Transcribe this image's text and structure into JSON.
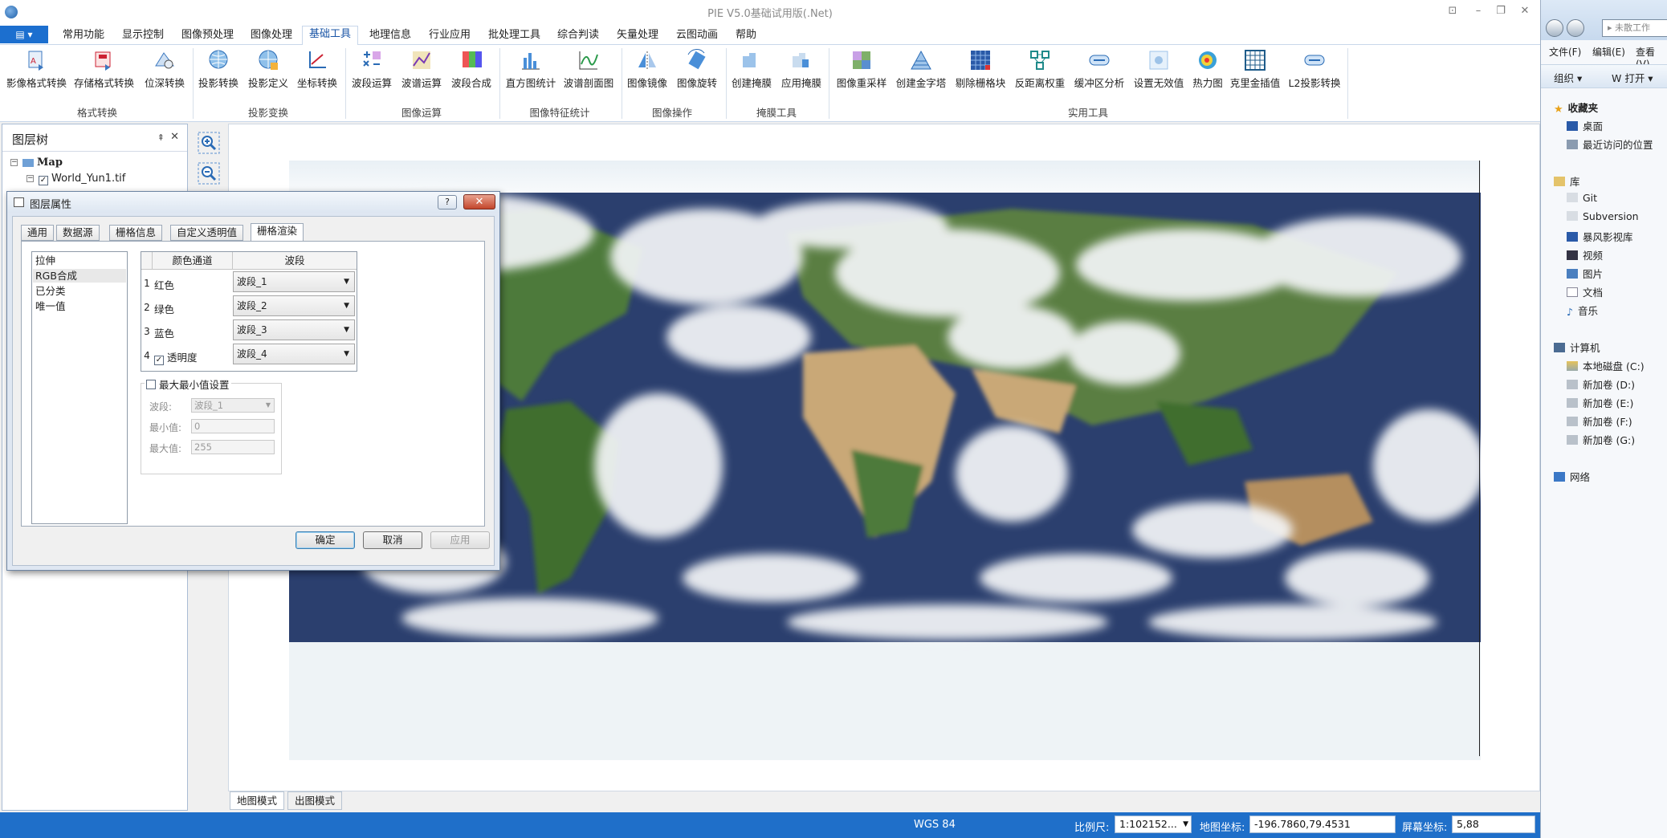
{
  "window": {
    "title": "PIE V5.0基础试用版(.Net)"
  },
  "ribbon": {
    "app_menu_label": "▤ ▾",
    "tabs": [
      "常用功能",
      "显示控制",
      "图像预处理",
      "图像处理",
      "基础工具",
      "地理信息",
      "行业应用",
      "批处理工具",
      "综合判读",
      "矢量处理",
      "云图动画",
      "帮助"
    ],
    "active_tab": "基础工具",
    "groups": [
      {
        "label": "格式转换",
        "buttons": [
          "影像格式转换",
          "存储格式转换",
          "位深转换"
        ]
      },
      {
        "label": "投影变换",
        "buttons": [
          "投影转换",
          "投影定义",
          "坐标转换"
        ]
      },
      {
        "label": "图像运算",
        "buttons": [
          "波段运算",
          "波谱运算",
          "波段合成"
        ]
      },
      {
        "label": "图像特征统计",
        "buttons": [
          "直方图统计",
          "波谱剖面图"
        ]
      },
      {
        "label": "图像操作",
        "buttons": [
          "图像镜像",
          "图像旋转"
        ]
      },
      {
        "label": "掩膜工具",
        "buttons": [
          "创建掩膜",
          "应用掩膜"
        ]
      },
      {
        "label": "实用工具",
        "buttons": [
          "图像重采样",
          "创建金字塔",
          "剔除栅格块",
          "反距离权重",
          "缓冲区分析",
          "设置无效值",
          "热力图",
          "克里金插值",
          "L2投影转换"
        ]
      }
    ]
  },
  "layer_panel": {
    "title": "图层树",
    "pin": "⇞",
    "close": "✕",
    "root": "Map",
    "layer": "World_Yun1.tif",
    "layer_checked": true
  },
  "map": {
    "bottom_tabs": [
      "地图模式",
      "出图模式"
    ],
    "active_bottom_tab": "地图模式"
  },
  "statusbar": {
    "crs": "WGS 84",
    "scale_label": "比例尺:",
    "scale_value": "1:102152...",
    "map_coord_label": "地图坐标:",
    "map_coord_value": "-196.7860,79.4531",
    "screen_coord_label": "屏幕坐标:",
    "screen_coord_value": "5,88"
  },
  "dialog": {
    "title": "图层属性",
    "help": "?",
    "close": "✕",
    "tabs": [
      "通用",
      "数据源",
      "栅格信息",
      "自定义透明值",
      "栅格渲染"
    ],
    "active_tab": "栅格渲染",
    "render_types": [
      "拉伸",
      "RGB合成",
      "已分类",
      "唯一值"
    ],
    "selected_render_type": "RGB合成",
    "table_headers": [
      "颜色通道",
      "波段"
    ],
    "channels": [
      {
        "num": "1",
        "name": "红色",
        "band": "波段_1",
        "has_checkbox": false
      },
      {
        "num": "2",
        "name": "绿色",
        "band": "波段_2",
        "has_checkbox": false
      },
      {
        "num": "3",
        "name": "蓝色",
        "band": "波段_3",
        "has_checkbox": false
      },
      {
        "num": "4",
        "name": "透明度",
        "band": "波段_4",
        "has_checkbox": true,
        "checked": true
      }
    ],
    "minmax": {
      "title": "最大最小值设置",
      "checked": false,
      "band_label": "波段:",
      "band_value": "波段_1",
      "min_label": "最小值:",
      "min_value": "0",
      "max_label": "最大值:",
      "max_value": "255"
    },
    "buttons": {
      "ok": "确定",
      "cancel": "取消",
      "apply": "应用"
    }
  },
  "explorer": {
    "address": "▸ 未散工作",
    "menu": [
      "文件(F)",
      "编辑(E)",
      "查看(V)"
    ],
    "cmd": [
      "组织 ▾",
      "W 打开 ▾"
    ],
    "favorites_header": "收藏夹",
    "favorites": [
      "桌面",
      "最近访问的位置"
    ],
    "library_header": "库",
    "libraries": [
      "Git",
      "Subversion",
      "暴风影视库",
      "视频",
      "图片",
      "文档",
      "音乐"
    ],
    "computer_header": "计算机",
    "drives": [
      "本地磁盘 (C:)",
      "新加卷 (D:)",
      "新加卷 (E:)",
      "新加卷 (F:)",
      "新加卷 (G:)"
    ],
    "network": "网络"
  },
  "colors": {
    "accent": "#1f6fc9",
    "ocean": "#2b3f6e",
    "land_green": "#4e7a3a",
    "desert": "#c9a877",
    "cloud": "#f4f6f8"
  }
}
